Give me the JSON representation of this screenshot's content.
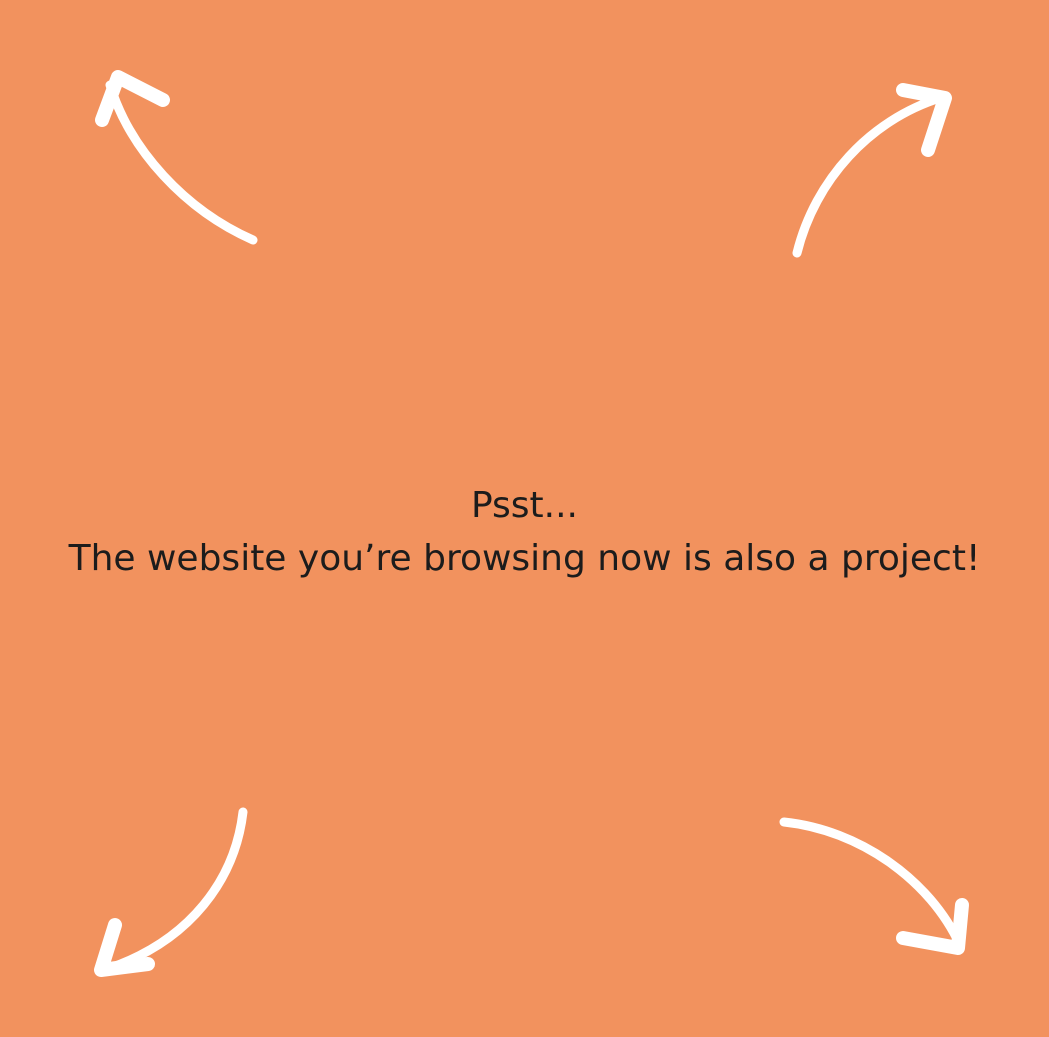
{
  "background_color": "#F2925E",
  "arrow_color": "#FFFFFF",
  "text_color": "#1C1C1C",
  "message": {
    "line1": "Psst...",
    "line2": "The website you’re browsing now is also a project!"
  },
  "icons": {
    "top_left": "curved-arrow-up-left",
    "top_right": "curved-arrow-up-right",
    "bottom_left": "curved-arrow-down-left",
    "bottom_right": "curved-arrow-down-right"
  }
}
